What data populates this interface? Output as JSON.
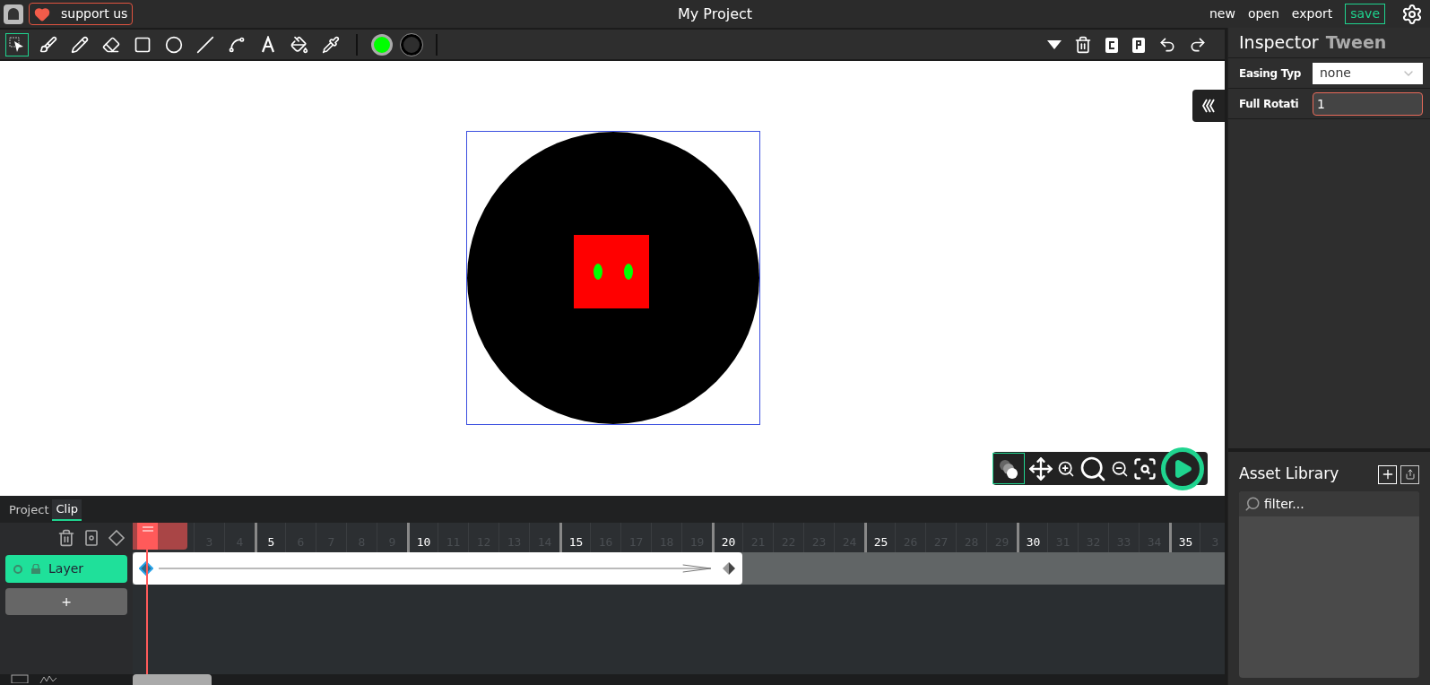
{
  "topbar": {
    "title": "My Project",
    "support": "support us",
    "menu": [
      {
        "label": "new"
      },
      {
        "label": "open"
      },
      {
        "label": "export"
      }
    ],
    "save": "save"
  },
  "tools": [
    {
      "kind": "select",
      "selected": true
    },
    {
      "kind": "brush",
      "selected": false
    },
    {
      "kind": "pencil",
      "selected": false
    },
    {
      "kind": "eraser",
      "selected": false
    },
    {
      "kind": "rectangle",
      "selected": false
    },
    {
      "kind": "ellipse",
      "selected": false
    },
    {
      "kind": "line",
      "selected": false
    },
    {
      "kind": "path",
      "selected": false
    },
    {
      "kind": "text",
      "selected": false
    },
    {
      "kind": "fill",
      "selected": false
    },
    {
      "kind": "eyedropper",
      "selected": false
    }
  ],
  "swatches": [
    {
      "kind": "fill",
      "color": "#00ff00"
    },
    {
      "kind": "stroke",
      "color": "#000000"
    }
  ],
  "inspector": {
    "title": "Inspector",
    "subtitle": "Tween",
    "fields": [
      {
        "kind": "select",
        "label": "Easing Typ",
        "value": "none",
        "focused": false
      },
      {
        "kind": "input",
        "label": "Full Rotati",
        "value": "1",
        "focused": true
      }
    ]
  },
  "assets": {
    "title": "Asset Library",
    "placeholder": "filter..."
  },
  "timeline": {
    "tabs": [
      {
        "label": "Project",
        "selected": false
      },
      {
        "label": "Clip",
        "selected": true
      }
    ],
    "layers": [
      {
        "name": "Layer",
        "selected": true
      }
    ],
    "add_layer": "+",
    "frames": [
      {
        "label": "3",
        "major": false
      },
      {
        "label": "4",
        "major": false
      },
      {
        "label": "5",
        "major": true
      },
      {
        "label": "6",
        "major": false
      },
      {
        "label": "7",
        "major": false
      },
      {
        "label": "8",
        "major": false
      },
      {
        "label": "9",
        "major": false
      },
      {
        "label": "10",
        "major": true
      },
      {
        "label": "11",
        "major": false
      },
      {
        "label": "12",
        "major": false
      },
      {
        "label": "13",
        "major": false
      },
      {
        "label": "14",
        "major": false
      },
      {
        "label": "15",
        "major": true
      },
      {
        "label": "16",
        "major": false
      },
      {
        "label": "17",
        "major": false
      },
      {
        "label": "18",
        "major": false
      },
      {
        "label": "19",
        "major": false
      },
      {
        "label": "20",
        "major": true,
        "keyframe": true
      },
      {
        "label": "21",
        "major": false
      },
      {
        "label": "22",
        "major": false
      },
      {
        "label": "23",
        "major": false
      },
      {
        "label": "24",
        "major": false
      },
      {
        "label": "25",
        "major": true
      },
      {
        "label": "26",
        "major": false
      },
      {
        "label": "27",
        "major": false
      },
      {
        "label": "28",
        "major": false
      },
      {
        "label": "29",
        "major": false
      },
      {
        "label": "30",
        "major": true
      },
      {
        "label": "31",
        "major": false
      },
      {
        "label": "32",
        "major": false
      },
      {
        "label": "33",
        "major": false
      },
      {
        "label": "34",
        "major": false
      },
      {
        "label": "35",
        "major": true
      },
      {
        "label": "3",
        "major": false
      }
    ]
  }
}
